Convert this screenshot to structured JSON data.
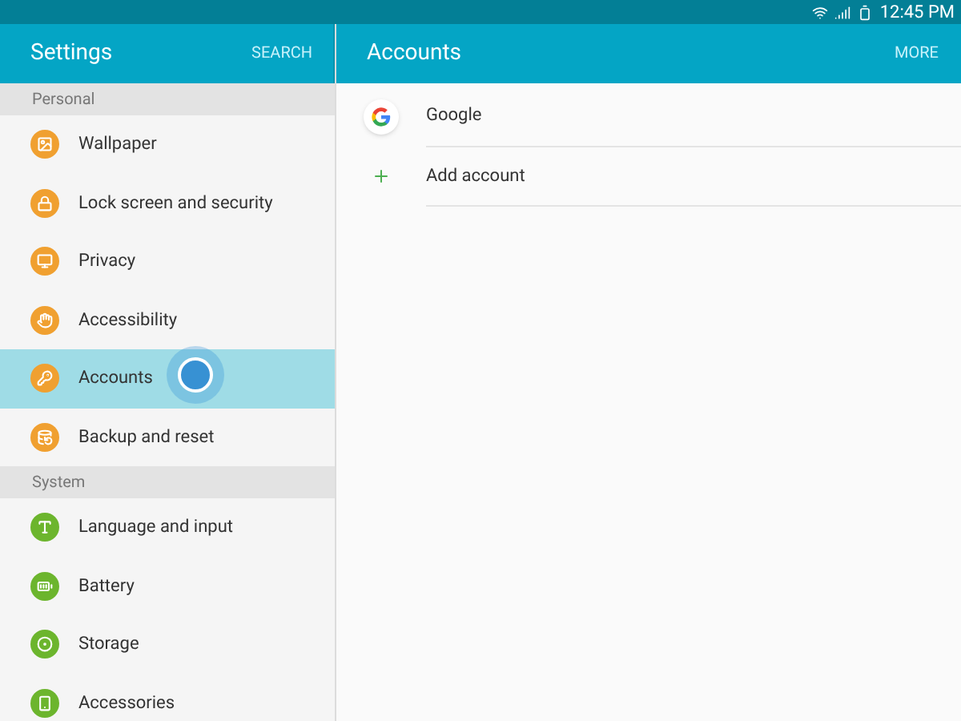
{
  "status_bar": {
    "time": "12:45 PM"
  },
  "left_header": {
    "title": "Settings",
    "action": "SEARCH"
  },
  "right_header": {
    "title": "Accounts",
    "action": "MORE"
  },
  "sections": [
    {
      "title": "Personal",
      "items": [
        {
          "label": "Wallpaper",
          "selected": false,
          "color": "#f0a030"
        },
        {
          "label": "Lock screen and security",
          "selected": false,
          "color": "#f0a030"
        },
        {
          "label": "Privacy",
          "selected": false,
          "color": "#f0a030"
        },
        {
          "label": "Accessibility",
          "selected": false,
          "color": "#f0a030"
        },
        {
          "label": "Accounts",
          "selected": true,
          "color": "#f0a030"
        },
        {
          "label": "Backup and reset",
          "selected": false,
          "color": "#f0a030"
        }
      ]
    },
    {
      "title": "System",
      "items": [
        {
          "label": "Language and input",
          "selected": false,
          "color": "#6cb52d"
        },
        {
          "label": "Battery",
          "selected": false,
          "color": "#6cb52d"
        },
        {
          "label": "Storage",
          "selected": false,
          "color": "#6cb52d"
        },
        {
          "label": "Accessories",
          "selected": false,
          "color": "#6cb52d"
        }
      ]
    }
  ],
  "accounts": [
    {
      "kind": "account",
      "label": "Google"
    },
    {
      "kind": "add",
      "label": "Add account"
    }
  ]
}
